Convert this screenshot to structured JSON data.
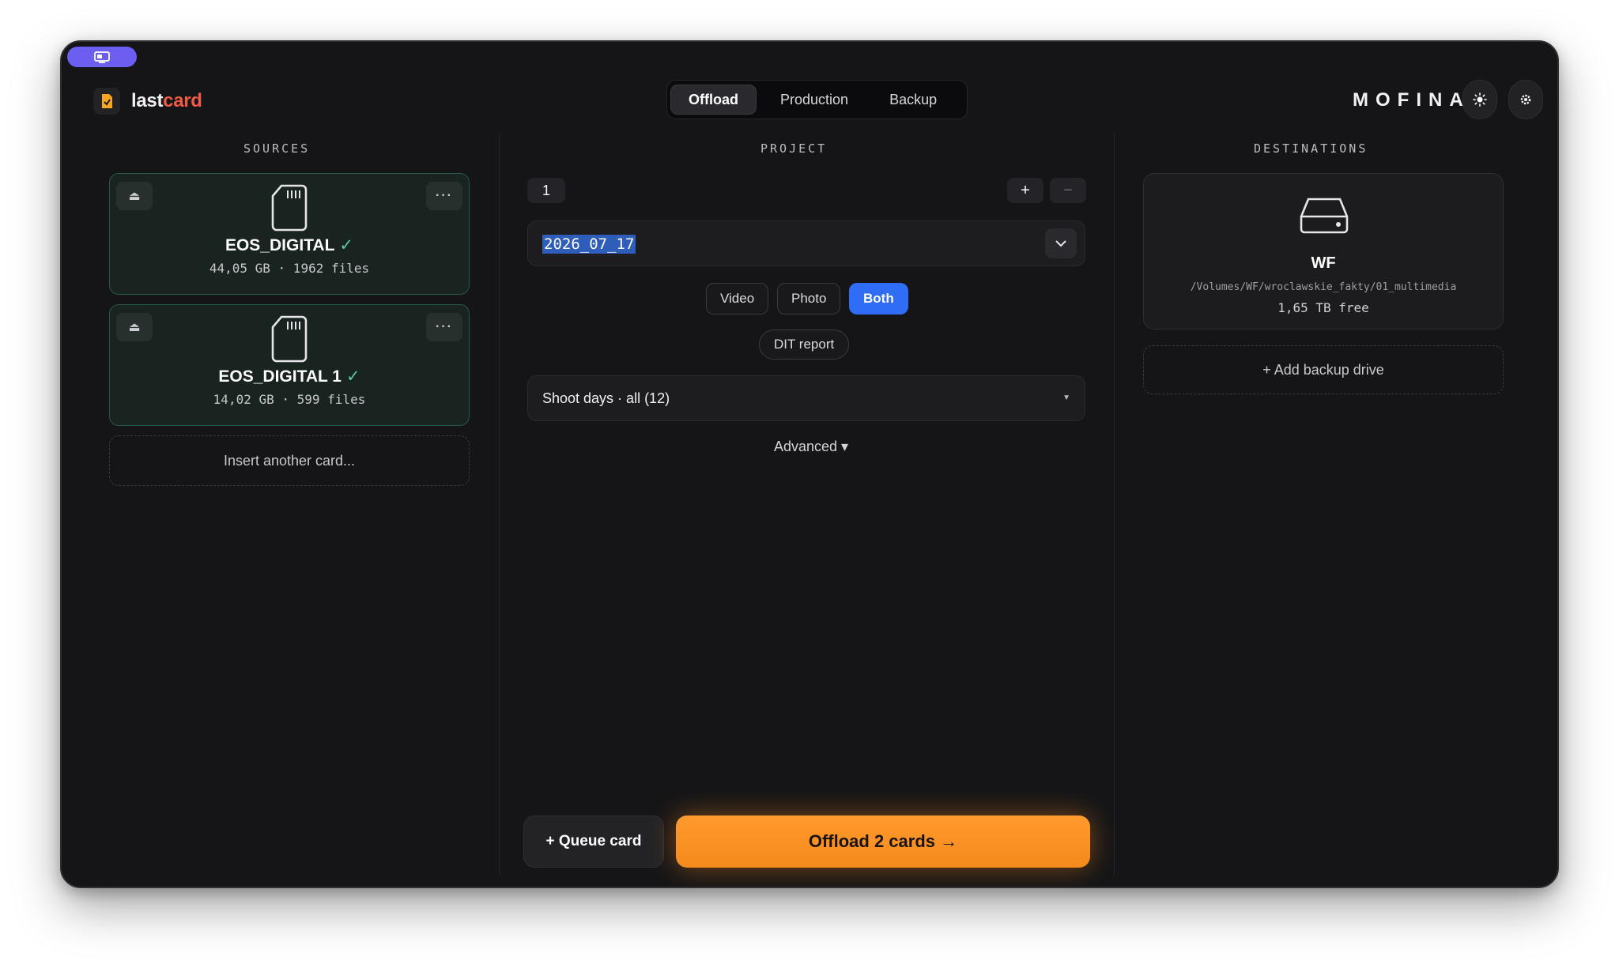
{
  "app": {
    "name_part1": "last",
    "name_part2": "card",
    "brand": "MOFINA"
  },
  "tabs": [
    {
      "label": "Offload",
      "active": true
    },
    {
      "label": "Production",
      "active": false
    },
    {
      "label": "Backup",
      "active": false
    }
  ],
  "header_buttons": {
    "theme_icon": "sun-icon",
    "settings_icon": "gear-icon"
  },
  "sources": {
    "title": "SOURCES",
    "cards": [
      {
        "name": "EOS_DIGITAL",
        "check": "✓",
        "meta": "44,05 GB · 1962 files"
      },
      {
        "name": "EOS_DIGITAL 1",
        "check": "✓",
        "meta": "14,02 GB · 599 files"
      }
    ],
    "insert_label": "Insert another card..."
  },
  "project": {
    "title": "PROJECT",
    "number": "1",
    "plus": "+",
    "minus": "−",
    "date": "2026_07_17",
    "media_types": [
      {
        "label": "Video",
        "active": false
      },
      {
        "label": "Photo",
        "active": false
      },
      {
        "label": "Both",
        "active": true
      }
    ],
    "dit_report": "DIT report",
    "shoot_days": "Shoot days · all (12)",
    "advanced": "Advanced ▾"
  },
  "destinations": {
    "title": "DESTINATIONS",
    "drive": {
      "name": "WF",
      "path": "/Volumes/WF/wroclawskie_fakty/01_multimedia",
      "free": "1,65 TB free"
    },
    "add_backup": "+ Add backup drive"
  },
  "actions": {
    "queue": "+ Queue card",
    "offload": "Offload 2 cards →"
  },
  "colors": {
    "accent_orange": "#f58a1c",
    "accent_blue": "#2f6df6",
    "brand_red": "#f05a47",
    "source_green": "#27594a"
  }
}
